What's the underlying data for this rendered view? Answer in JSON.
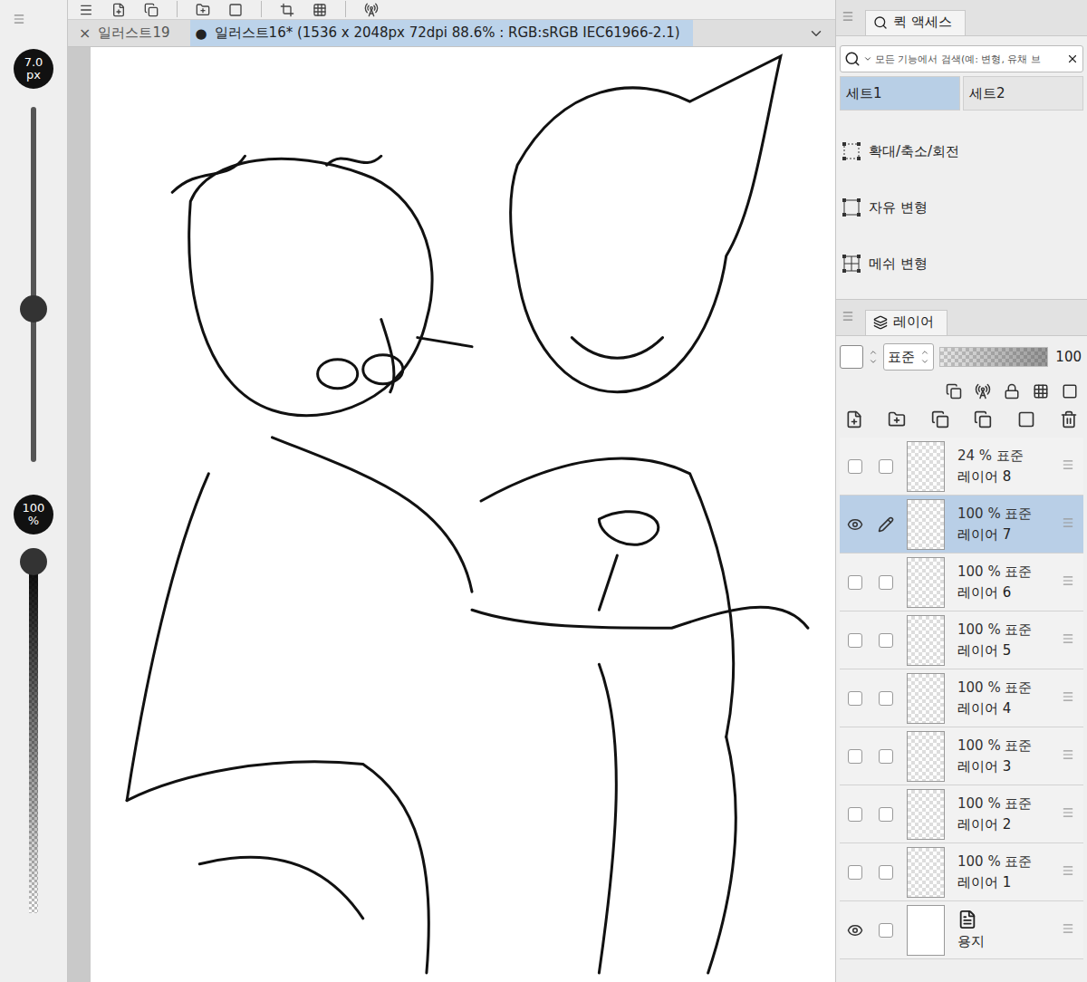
{
  "tool_property": {
    "brush_size": "7.0",
    "brush_size_unit": "px",
    "brush_size_level": 0.43,
    "opacity": "100",
    "opacity_unit": "%",
    "opacity_level": 0.97
  },
  "document_tabs": [
    {
      "label": "일러스트19",
      "close": "×",
      "modified_mark": "",
      "selected": false
    },
    {
      "label": "일러스트16* (1536 x 2048px 72dpi 88.6% : RGB:sRGB IEC61966-2.1)",
      "close": "",
      "modified_mark": "●",
      "selected": true
    }
  ],
  "quick_access": {
    "title": "퀵 액세스",
    "search_placeholder": "모든 기능에서 검색(예: 변형, 유채 브",
    "sets": [
      {
        "label": "세트1",
        "selected": true
      },
      {
        "label": "세트2",
        "selected": false
      }
    ],
    "items": [
      "확대/축소/회전",
      "자유 변형",
      "메쉬 변형"
    ]
  },
  "layers": {
    "title": "레이어",
    "blend_mode": "표준",
    "opacity": "100",
    "opacity_level": 1,
    "items": [
      {
        "name": "레이어 8",
        "opacity": "24 %",
        "blend": "표준",
        "visible": false,
        "editing": false,
        "selected": false,
        "kind": "raster"
      },
      {
        "name": "레이어 7",
        "opacity": "100 %",
        "blend": "표준",
        "visible": true,
        "editing": true,
        "selected": true,
        "kind": "raster"
      },
      {
        "name": "레이어 6",
        "opacity": "100 %",
        "blend": "표준",
        "visible": false,
        "editing": false,
        "selected": false,
        "kind": "raster"
      },
      {
        "name": "레이어 5",
        "opacity": "100 %",
        "blend": "표준",
        "visible": false,
        "editing": false,
        "selected": false,
        "kind": "raster"
      },
      {
        "name": "레이어 4",
        "opacity": "100 %",
        "blend": "표준",
        "visible": false,
        "editing": false,
        "selected": false,
        "kind": "raster"
      },
      {
        "name": "레이어 3",
        "opacity": "100 %",
        "blend": "표준",
        "visible": false,
        "editing": false,
        "selected": false,
        "kind": "raster"
      },
      {
        "name": "레이어 2",
        "opacity": "100 %",
        "blend": "표준",
        "visible": false,
        "editing": false,
        "selected": false,
        "kind": "raster"
      },
      {
        "name": "레이어 1",
        "opacity": "100 %",
        "blend": "표준",
        "visible": false,
        "editing": false,
        "selected": false,
        "kind": "raster"
      },
      {
        "name": "용지",
        "opacity": "",
        "blend": "",
        "visible": true,
        "editing": false,
        "selected": false,
        "kind": "paper"
      }
    ]
  }
}
